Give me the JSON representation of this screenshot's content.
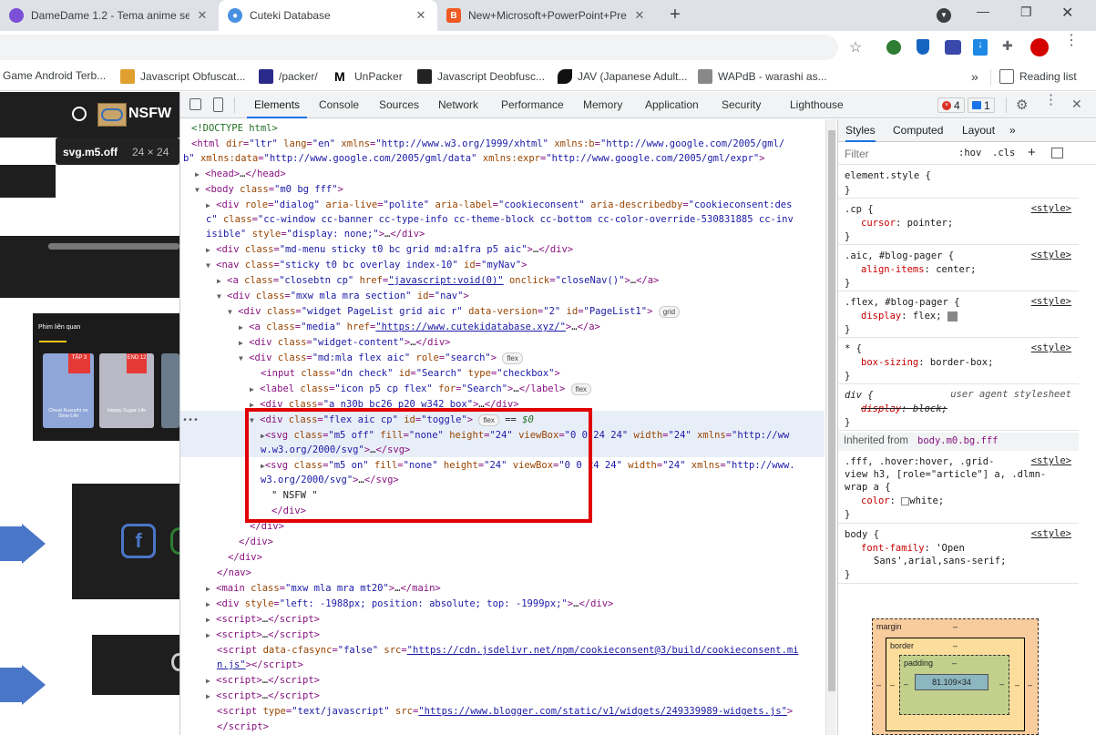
{
  "browser": {
    "tabs": [
      {
        "title": "DameDame 1.2 - Tema anime se",
        "close": "✕"
      },
      {
        "title": "Cuteki Database",
        "close": "✕"
      },
      {
        "title": "New+Microsoft+PowerPoint+Pre",
        "close": "✕"
      }
    ],
    "new_tab": "+",
    "window_controls": {
      "minimize": "—",
      "maximize": "❐",
      "close": "✕"
    },
    "bookmarks": [
      {
        "label": "Game Android Terb..."
      },
      {
        "label": "Javascript Obfuscat..."
      },
      {
        "label": "/packer/"
      },
      {
        "label": "UnPacker"
      },
      {
        "label": "Javascript Deobfusc..."
      },
      {
        "label": "JAV (Japanese Adult..."
      },
      {
        "label": "WAPdB - warashi as..."
      }
    ],
    "bookmarks_more": "»",
    "reading_list": "Reading list"
  },
  "page": {
    "nsfw_label": "NSFW",
    "tooltip_selector": "svg.m5.off",
    "tooltip_size": "24 × 24",
    "card_title": "Phim liên quan",
    "posters": [
      {
        "badge": "TẬP 3",
        "caption": "Cheat Kusushi no Slow Life"
      },
      {
        "badge": "END 12",
        "caption": "Happy Sugar Life"
      }
    ]
  },
  "devtools": {
    "tabs": [
      "Elements",
      "Console",
      "Sources",
      "Network",
      "Performance",
      "Memory",
      "Application",
      "Security",
      "Lighthouse"
    ],
    "active_tab": "Elements",
    "error_count": "4",
    "message_count": "1",
    "styles_tabs": [
      "Styles",
      "Computed",
      "Layout"
    ],
    "filter_placeholder": "Filter",
    "hov": ":hov",
    "cls": ".cls",
    "inherited_from": "Inherited from",
    "inherited_selector": "body.m0.bg.fff",
    "box_model": {
      "margin": "margin",
      "border": "border",
      "padding": "padding",
      "dash": "–",
      "content": "81.109×34"
    }
  },
  "colors": {
    "accent": "#1a73e8",
    "highlight_box": "#e00000",
    "selected_row": "#e8eef8"
  }
}
